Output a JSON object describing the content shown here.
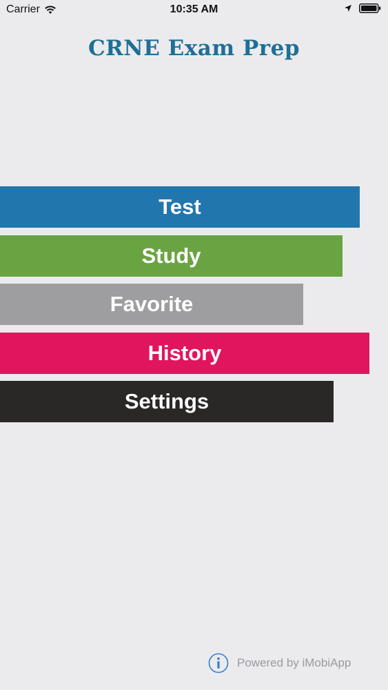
{
  "status_bar": {
    "carrier": "Carrier",
    "time": "10:35 AM",
    "icons": [
      "wifi-icon",
      "location-arrow-icon",
      "battery-icon"
    ]
  },
  "app": {
    "title": "CRNE Exam Prep",
    "title_color": "#1f6f96"
  },
  "menu": [
    {
      "label": "Test",
      "color": "#2176ae"
    },
    {
      "label": "Study",
      "color": "#6aa442"
    },
    {
      "label": "Favorite",
      "color": "#9e9d9f"
    },
    {
      "label": "History",
      "color": "#e1155e"
    },
    {
      "label": "Settings",
      "color": "#2a2727"
    }
  ],
  "footer": {
    "powered_by": "Powered by iMobiApp",
    "icon": "info-icon",
    "icon_color": "#2f7fd6"
  }
}
